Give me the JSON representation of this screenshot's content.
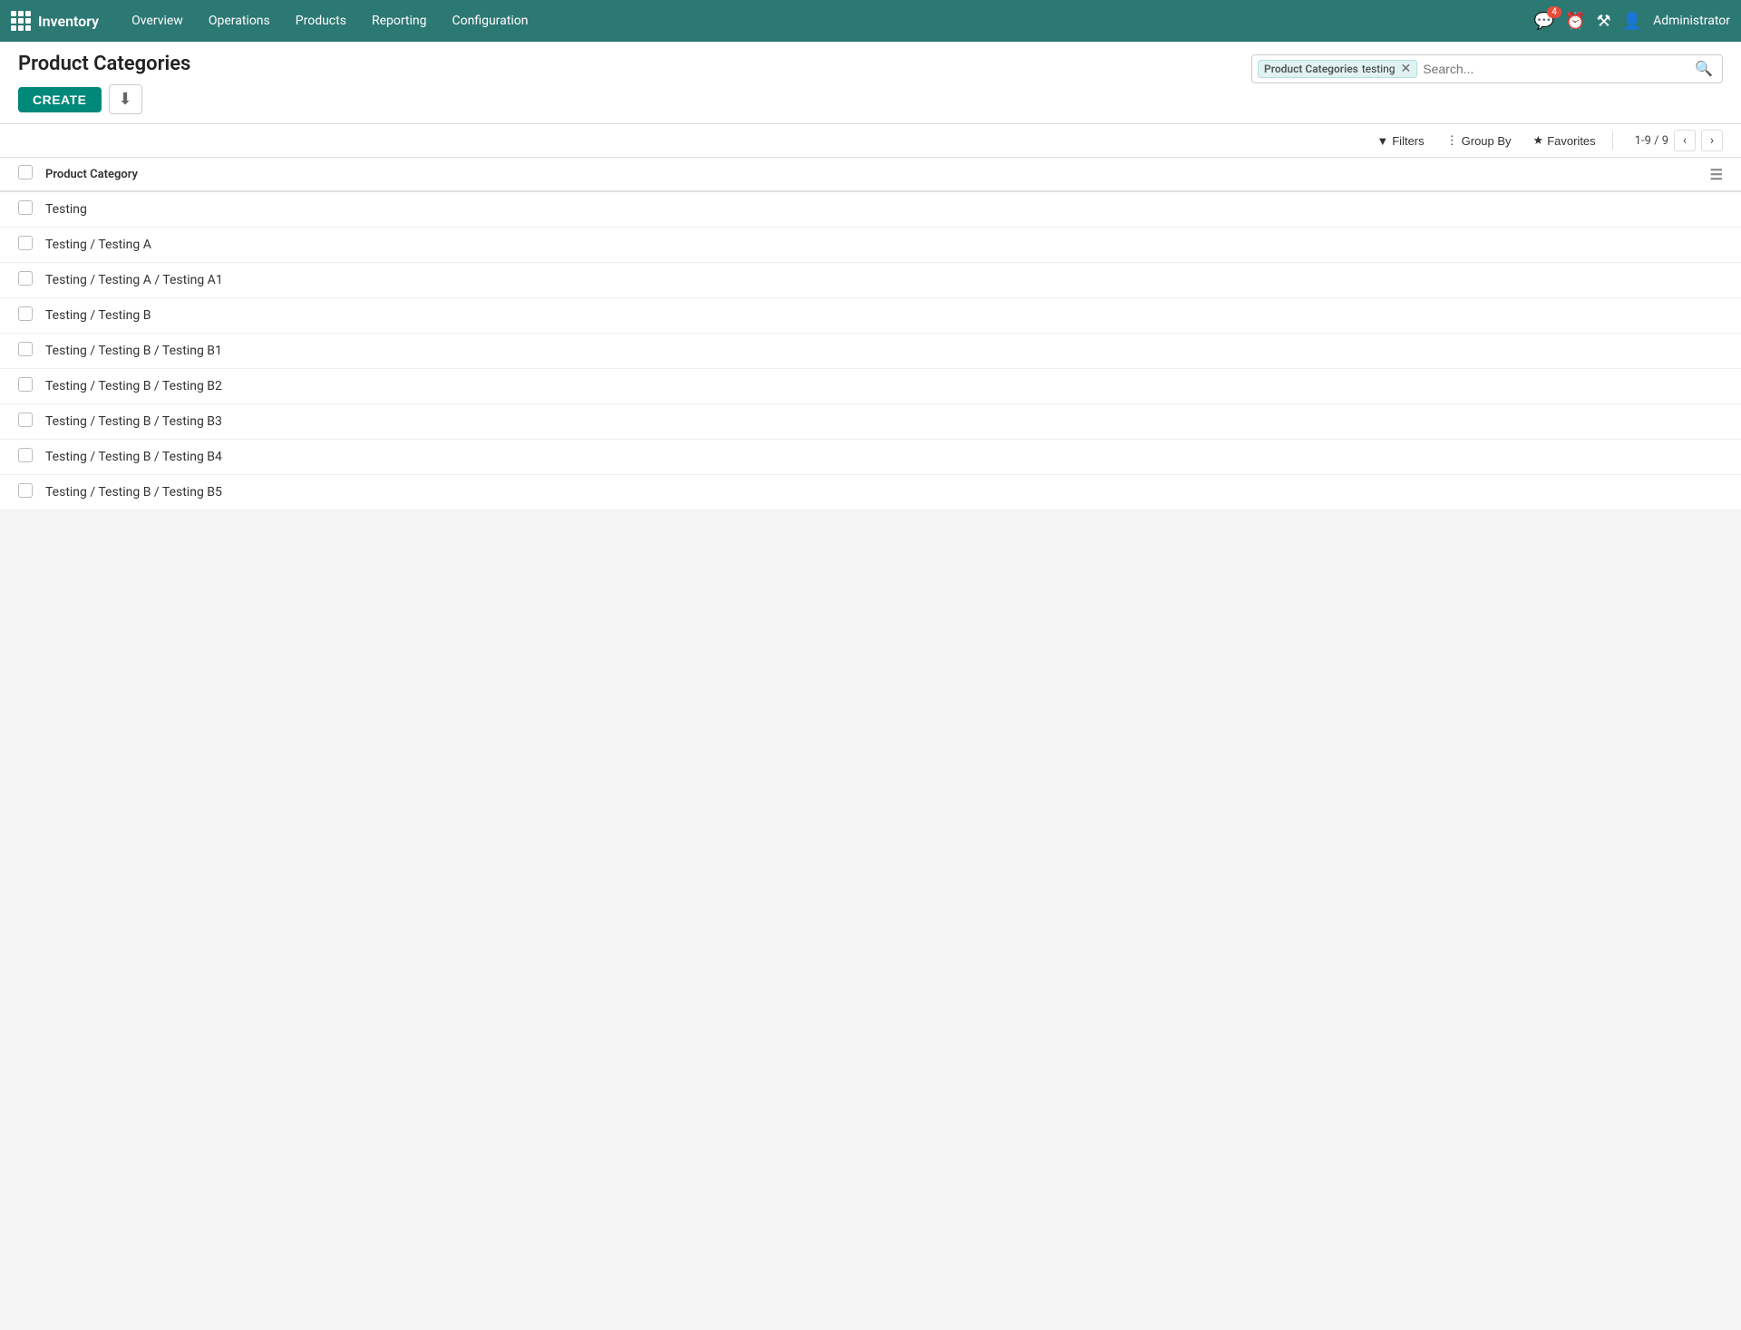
{
  "app": {
    "name": "Inventory",
    "nav": [
      "Overview",
      "Operations",
      "Products",
      "Reporting",
      "Configuration"
    ]
  },
  "topnav": {
    "badge_count": "4",
    "user_label": "Administrator"
  },
  "page": {
    "title": "Product Categories",
    "create_label": "CREATE"
  },
  "search": {
    "tag_label": "Product Categories",
    "tag_value": "testing",
    "placeholder": "Search..."
  },
  "toolbar": {
    "filters_label": "Filters",
    "groupby_label": "Group By",
    "favorites_label": "Favorites",
    "pagination": "1-9 / 9"
  },
  "list": {
    "header": "Product Category",
    "rows": [
      {
        "label": "Testing"
      },
      {
        "label": "Testing / Testing A"
      },
      {
        "label": "Testing / Testing A / Testing A1"
      },
      {
        "label": "Testing / Testing B"
      },
      {
        "label": "Testing / Testing B / Testing B1"
      },
      {
        "label": "Testing / Testing B / Testing B2"
      },
      {
        "label": "Testing / Testing B / Testing B3"
      },
      {
        "label": "Testing / Testing B / Testing B4"
      },
      {
        "label": "Testing / Testing B / Testing B5"
      }
    ]
  }
}
